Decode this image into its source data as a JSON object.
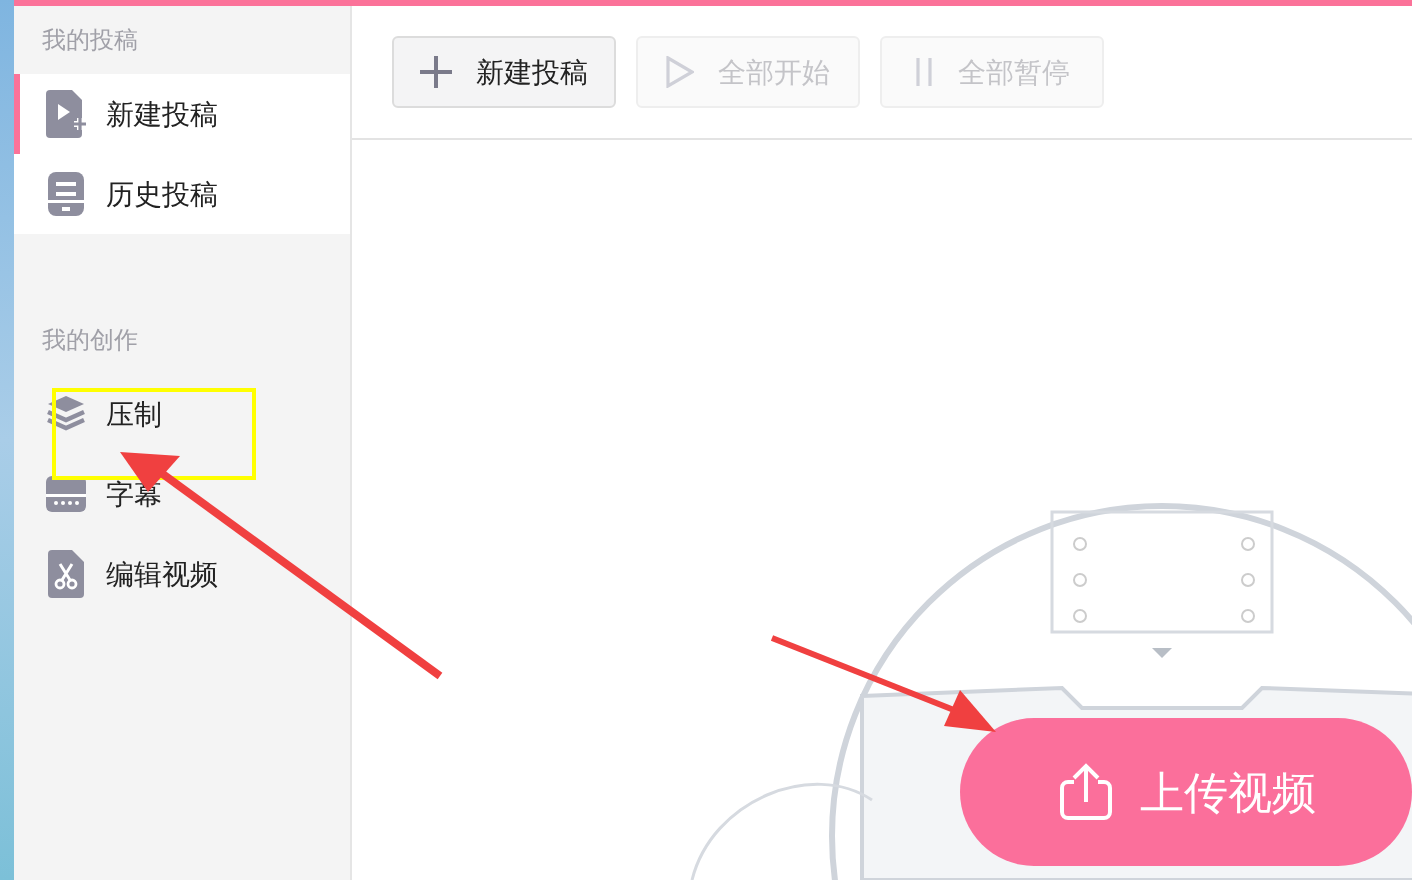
{
  "sidebar": {
    "sections": [
      {
        "heading": "我的投稿",
        "items": [
          {
            "kind": "new",
            "label": "新建投稿",
            "selected": true
          },
          {
            "kind": "history",
            "label": "历史投稿",
            "selected": false
          }
        ]
      },
      {
        "heading": "我的创作",
        "items": [
          {
            "kind": "layers",
            "label": "压制",
            "selected": false
          },
          {
            "kind": "subtitle",
            "label": "字幕",
            "selected": false
          },
          {
            "kind": "edit",
            "label": "编辑视频",
            "selected": false
          }
        ]
      }
    ]
  },
  "toolbar": {
    "buttons": [
      {
        "kind": "plus",
        "label": "新建投稿",
        "disabled": false
      },
      {
        "kind": "play",
        "label": "全部开始",
        "disabled": true
      },
      {
        "kind": "pause",
        "label": "全部暂停",
        "disabled": true
      }
    ]
  },
  "upload_button": {
    "label": "上传视频"
  }
}
